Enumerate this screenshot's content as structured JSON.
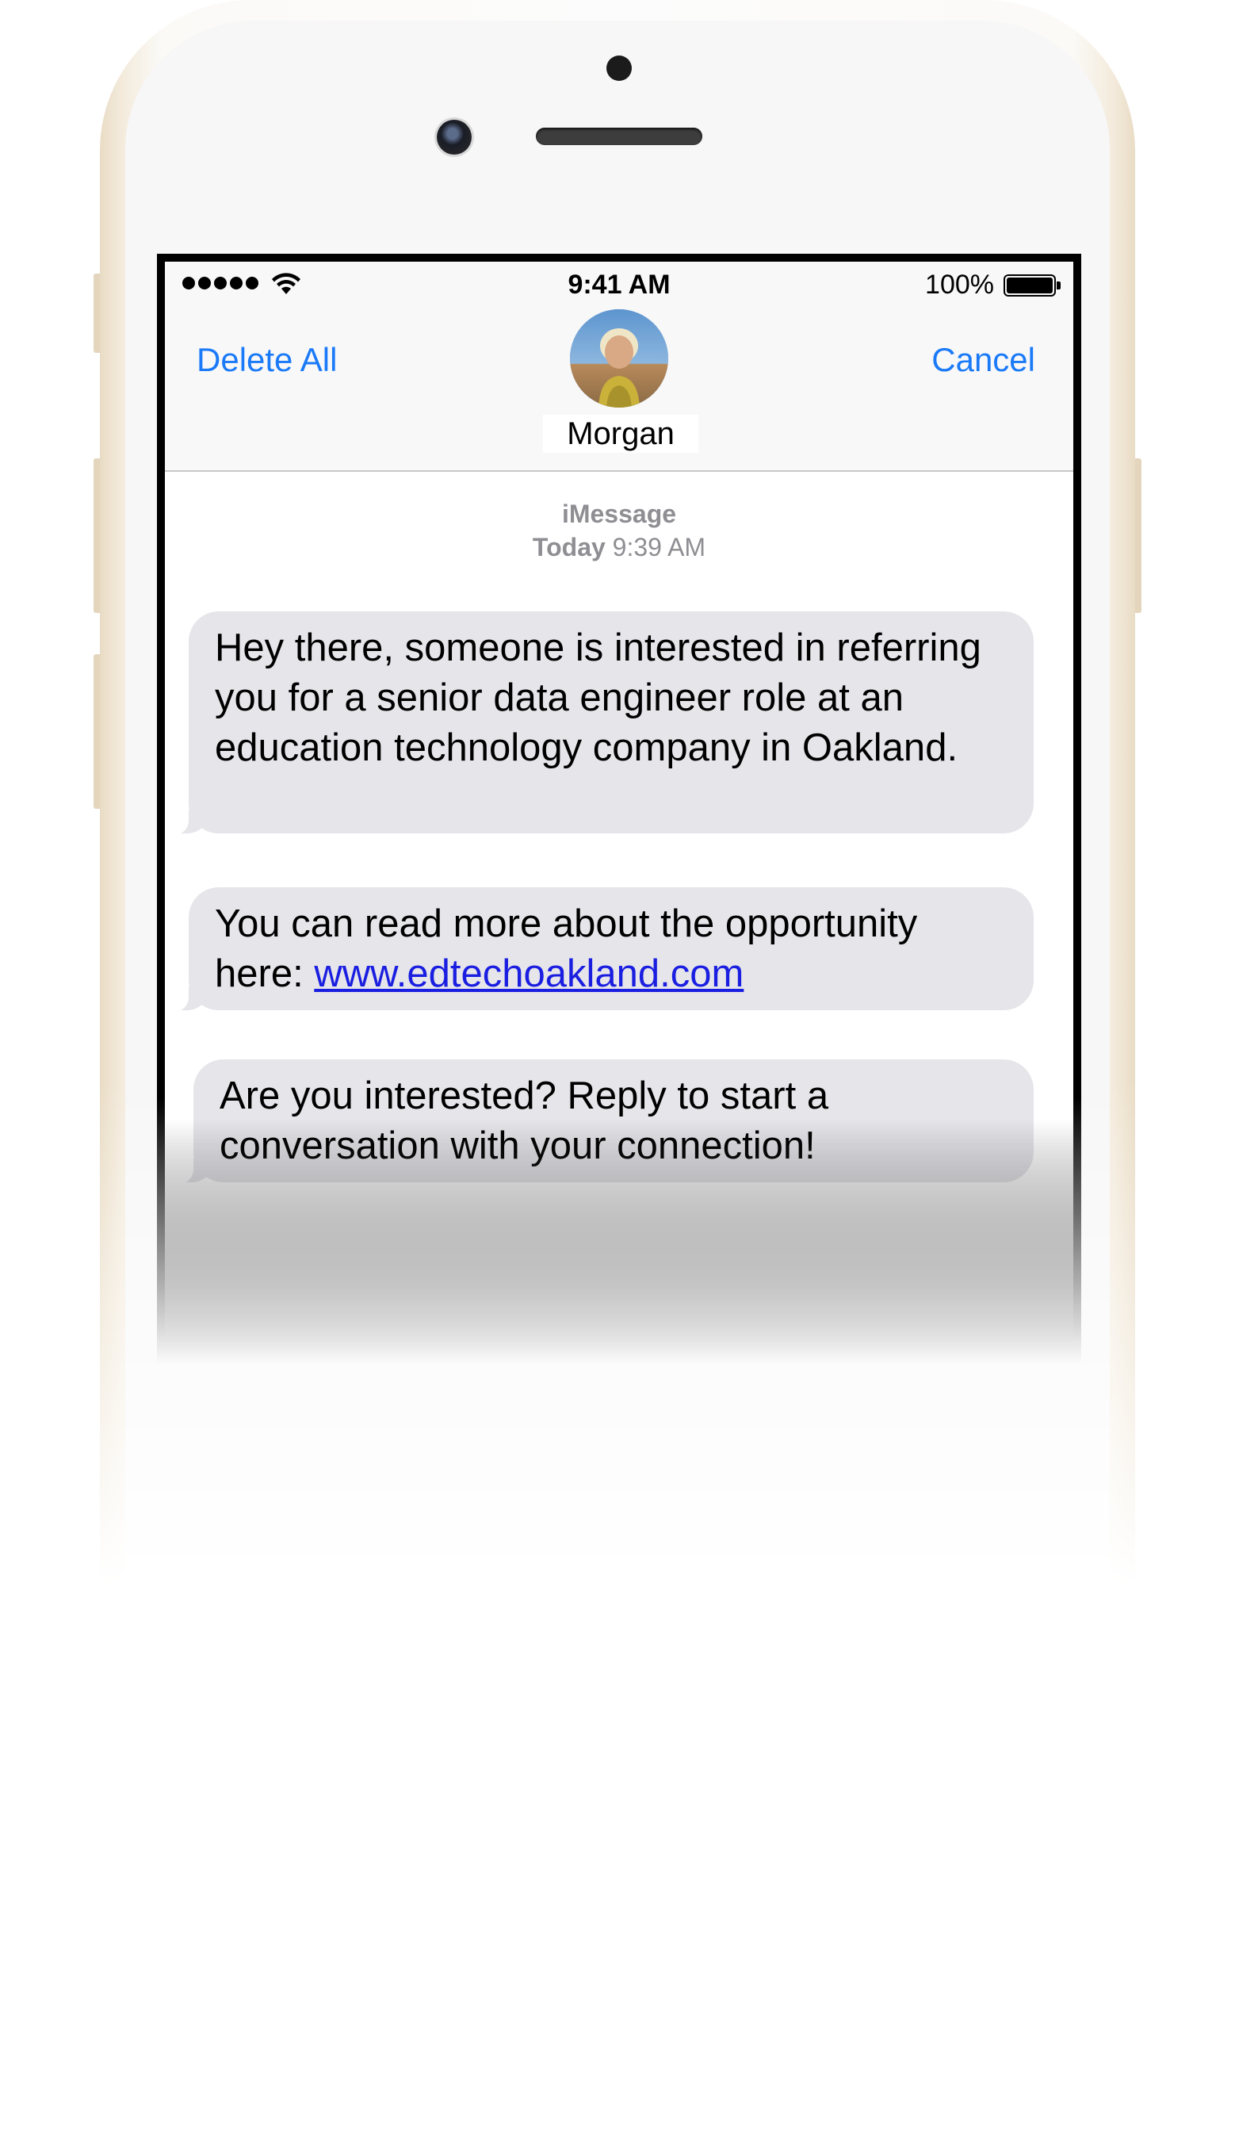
{
  "status_bar": {
    "time": "9:41 AM",
    "battery": "100%"
  },
  "nav": {
    "left_button": "Delete All",
    "right_button": "Cancel",
    "contact_name": "Morgan"
  },
  "thread": {
    "service": "iMessage",
    "day": "Today",
    "time": "9:39 AM"
  },
  "messages": [
    {
      "text": "Hey there, someone is interested in referring you for a senior data engineer role at an education technology company in Oakland."
    },
    {
      "text_before_link": "You can read more about the opportunity here: ",
      "link": "www.edtechoakland.com"
    },
    {
      "text": "Are you interested? Reply to start a conversation with your connection!"
    }
  ],
  "colors": {
    "accent": "#1a7af8",
    "bubble": "#e5e5ea",
    "link": "#1a1ee0",
    "meta_text": "#8e8e93"
  },
  "icons": [
    "signal-dots-icon",
    "wifi-icon",
    "battery-icon",
    "front-camera-icon",
    "earpiece-icon"
  ]
}
